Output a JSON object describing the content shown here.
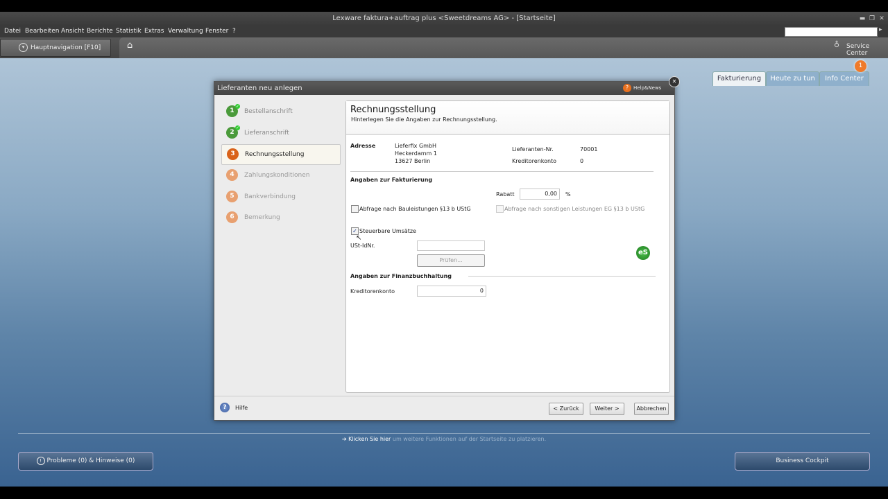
{
  "window": {
    "title": "Lexware faktura+auftrag plus <Sweetdreams AG> - [Startseite]",
    "minimize": "▬",
    "restore": "❐",
    "close": "✕"
  },
  "menu": [
    "Datei",
    "Bearbeiten",
    "Ansicht",
    "Berichte",
    "Statistik",
    "Extras",
    "Verwaltung",
    "Fenster",
    "?"
  ],
  "nav": {
    "hauptnavigation": "Hauptnavigation [F10]",
    "service_center": "Service Center"
  },
  "tabs": {
    "fakturierung": "Fakturierung",
    "heute": "Heute zu tun",
    "info": "Info Center",
    "info_badge": "1"
  },
  "dialog": {
    "title": "Lieferanten neu anlegen",
    "help_news": "Help&News",
    "close": "✕",
    "steps": [
      {
        "num": "1",
        "label": "Bestellanschrift",
        "state": "done"
      },
      {
        "num": "2",
        "label": "Lieferanschrift",
        "state": "done"
      },
      {
        "num": "3",
        "label": "Rechnungsstellung",
        "state": "active"
      },
      {
        "num": "4",
        "label": "Zahlungskonditionen",
        "state": "todo"
      },
      {
        "num": "5",
        "label": "Bankverbindung",
        "state": "todo"
      },
      {
        "num": "6",
        "label": "Bemerkung",
        "state": "todo"
      }
    ],
    "panel": {
      "heading": "Rechnungsstellung",
      "subheading": "Hinterlegen Sie die Angaben zur Rechnungsstellung.",
      "adresse_label": "Adresse",
      "adresse_lines": [
        "Lieferfix GmbH",
        "Heckerdamm 1",
        "13627 Berlin"
      ],
      "lieferanten_nr_label": "Lieferanten-Nr.",
      "lieferanten_nr_value": "70001",
      "kreditorenkonto_label": "Kreditorenkonto",
      "kreditorenkonto_value": "0",
      "faktura_section": "Angaben zur Fakturierung",
      "rabatt_label": "Rabatt",
      "rabatt_value": "0,00",
      "rabatt_unit": "%",
      "bauleistungen_label": "Abfrage nach Bauleistungen §13 b UStG",
      "sonstige_label": "Abfrage nach sonstigen Leistungen EG §13 b UStG",
      "steuerbar_label": "Steuerbare Umsätze",
      "ustid_label": "USt-IdNr.",
      "ustid_value": "",
      "pruefen_label": "Prüfen...",
      "es_badge": "eS",
      "fibu_section": "Angaben zur Finanzbuchhaltung",
      "fibu_kreditorenkonto_label": "Kreditorenkonto",
      "fibu_kreditorenkonto_value": "0"
    },
    "footer": {
      "hilfe": "Hilfe",
      "zurueck": "< Zurück",
      "weiter": "Weiter >",
      "abbrechen": "Abbrechen"
    }
  },
  "bottom": {
    "link_prefix": "Klicken Sie hier",
    "link_rest": "um weitere Funktionen auf der Startseite zu platzieren.",
    "probleme": "Probleme (0) & Hinweise (0)",
    "business_cockpit": "Business Cockpit"
  },
  "colors": {
    "step_done": "#4a9a3a",
    "step_active": "#d9621a",
    "step_todo": "#e8a070",
    "tab_orange": "#f07a2a"
  }
}
